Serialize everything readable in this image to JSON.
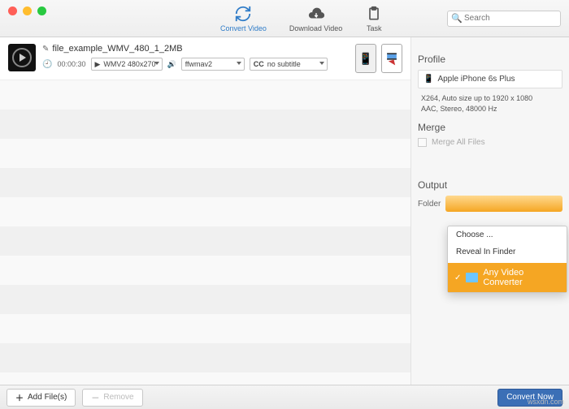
{
  "toolbar": {
    "convert_label": "Convert Video",
    "download_label": "Download Video",
    "task_label": "Task"
  },
  "search": {
    "placeholder": "Search"
  },
  "file": {
    "name": "file_example_WMV_480_1_2MB",
    "duration": "00:00:30",
    "video_sel": "WMV2 480x270",
    "audio_sel": "ffwmav2",
    "cc_sel": "no subtitle",
    "cc_prefix": "CC"
  },
  "profile": {
    "section": "Profile",
    "device": "Apple iPhone 6s Plus",
    "line1": "X264, Auto size up to 1920 x 1080",
    "line2": "AAC, Stereo, 48000 Hz"
  },
  "merge": {
    "section": "Merge",
    "label": "Merge All Files"
  },
  "output": {
    "section": "Output",
    "folder_label": "Folder"
  },
  "ctx": {
    "choose": "Choose ...",
    "reveal": "Reveal In Finder",
    "selected": "Any Video Converter"
  },
  "bottom": {
    "add": "Add File(s)",
    "remove": "Remove",
    "convert": "Convert Now"
  },
  "watermark": "wsxdn.com"
}
